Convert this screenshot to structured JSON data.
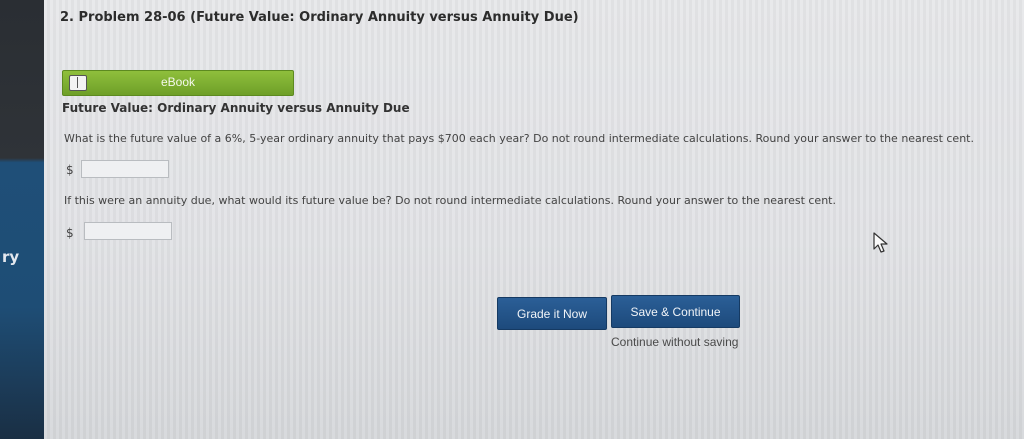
{
  "sidebar": {
    "label": "ry"
  },
  "problem": {
    "title": "2. Problem 28-06 (Future Value: Ordinary Annuity versus Annuity Due)"
  },
  "ebook": {
    "label": "eBook",
    "icon": "book-icon"
  },
  "section": {
    "heading": "Future Value: Ordinary Annuity versus Annuity Due"
  },
  "questions": [
    {
      "text": "What is the future value of a 6%, 5-year ordinary annuity that pays $700 each year? Do not round intermediate calculations. Round your answer to the nearest cent.",
      "currency": "$",
      "value": ""
    },
    {
      "text": "If this were an annuity due, what would its future value be? Do not round intermediate calculations. Round your answer to the nearest cent.",
      "currency": "$",
      "value": ""
    }
  ],
  "actions": {
    "grade_label": "Grade it Now",
    "save_label": "Save & Continue",
    "continue_label": "Continue without saving"
  },
  "colors": {
    "ebook_green": "#7aab2e",
    "button_blue": "#24548a",
    "sidebar_blue": "#1f4f78"
  },
  "cursor": "mouse-pointer-icon"
}
